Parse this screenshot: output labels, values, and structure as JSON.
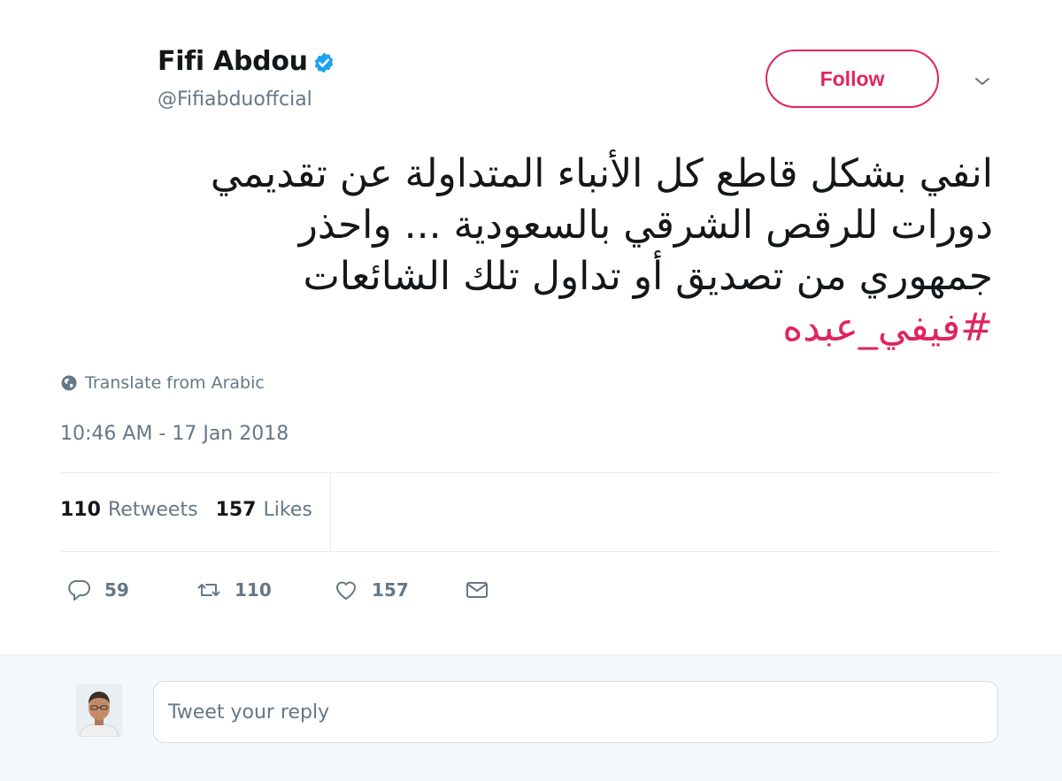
{
  "tweet": {
    "author_name": "Fifi Abdou",
    "handle": "@Fifiabduoffcial",
    "follow_label": "Follow",
    "text_lines": [
      "انفي بشكل قاطع كل الأنباء المتداولة عن تقديمي",
      "دورات للرقص الشرقي بالسعودية ... واحذر",
      "جمهوري من تصديق أو  تداول تلك الشائعات"
    ],
    "hashtag": "#فيفي_عبده",
    "translate_label": "Translate from Arabic",
    "timestamp": "10:46 AM - 17 Jan 2018"
  },
  "stats": {
    "retweets_count": "110",
    "retweets_label": "Retweets",
    "likes_count": "157",
    "likes_label": "Likes"
  },
  "actions": {
    "reply_count": "59",
    "retweet_count": "110",
    "like_count": "157"
  },
  "reply": {
    "placeholder": "Tweet your reply"
  },
  "colors": {
    "accent": "#e0245e",
    "verified": "#1da1f2",
    "secondary_text": "#657786"
  },
  "icons": [
    "verified-badge-icon",
    "chevron-down-icon",
    "globe-icon",
    "reply-icon",
    "retweet-icon",
    "like-icon",
    "direct-message-icon",
    "avatar"
  ]
}
